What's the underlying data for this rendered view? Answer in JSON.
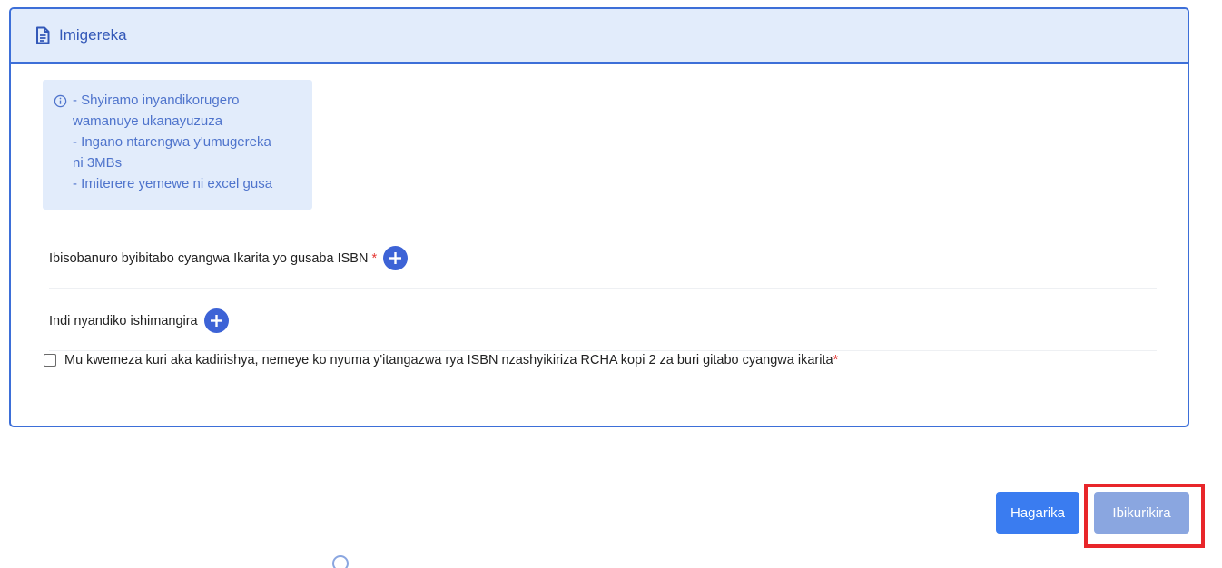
{
  "card": {
    "title": "Imigereka",
    "info": {
      "line1": "- Shyiramo inyandikorugero",
      "line2": "wamanuye ukanayuzuza",
      "line3": "- Ingano ntarengwa y'umugereka",
      "line4": "ni 3MBs",
      "line5": "- Imiterere yemewe ni excel gusa"
    },
    "field1": {
      "label": "Ibisobanuro byibitabo cyangwa Ikarita yo gusaba ISBN",
      "required_mark": "*"
    },
    "field2": {
      "label": "Indi nyandiko ishimangira"
    },
    "confirm": {
      "label": "Mu kwemeza kuri aka kadirishya, nemeye ko nyuma y'itangazwa rya ISBN nzashyikiriza RCHA kopi 2 za buri gitabo cyangwa ikarita",
      "required_mark": "*",
      "checked": false
    }
  },
  "actions": {
    "cancel_label": "Hagarika",
    "submit_label": "Ibikurikira"
  },
  "colors": {
    "accent": "#3d6fd8",
    "header_bg": "#e2ecfb",
    "cancel_bg": "#3a7cf0",
    "submit_bg": "#8aa6e0",
    "highlight": "#e8262a",
    "required": "#e53935"
  },
  "icons": {
    "header": "document-icon",
    "info": "info-circle-icon",
    "add": "plus-circle-icon"
  }
}
